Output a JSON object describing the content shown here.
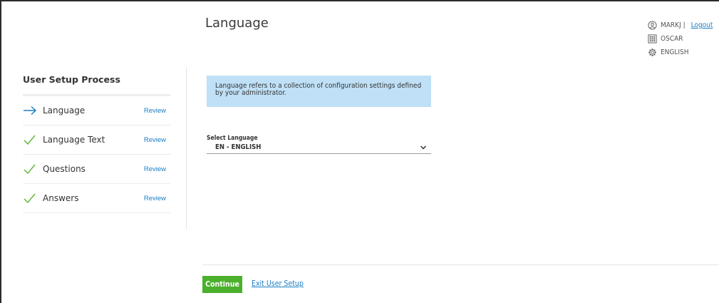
{
  "header": {
    "title": "Language"
  },
  "user": {
    "username": "MARKJ |",
    "logout_label": "Logout",
    "organization": "OSCAR",
    "language": "ENGLISH"
  },
  "sidebar": {
    "title": "User Setup Process",
    "steps": [
      {
        "label": "Language",
        "status": "current",
        "icon": "arrow-right-icon",
        "review_label": "Review"
      },
      {
        "label": "Language Text",
        "status": "complete",
        "icon": "check-icon",
        "review_label": "Review"
      },
      {
        "label": "Questions",
        "status": "complete",
        "icon": "check-icon",
        "review_label": "Review"
      },
      {
        "label": "Answers",
        "status": "complete",
        "icon": "check-icon",
        "review_label": "Review"
      }
    ]
  },
  "main": {
    "info_text": "Language refers to a collection of configuration settings defined by your administrator.",
    "select_label": "Select Language",
    "select_value": "EN - ENGLISH"
  },
  "footer": {
    "continue_label": "Continue",
    "exit_label": "Exit User Setup"
  },
  "colors": {
    "accent_blue": "#1a7dc4",
    "info_background": "#bfe0f6",
    "continue_green": "#4bb02c",
    "check_green": "#5cb531"
  }
}
